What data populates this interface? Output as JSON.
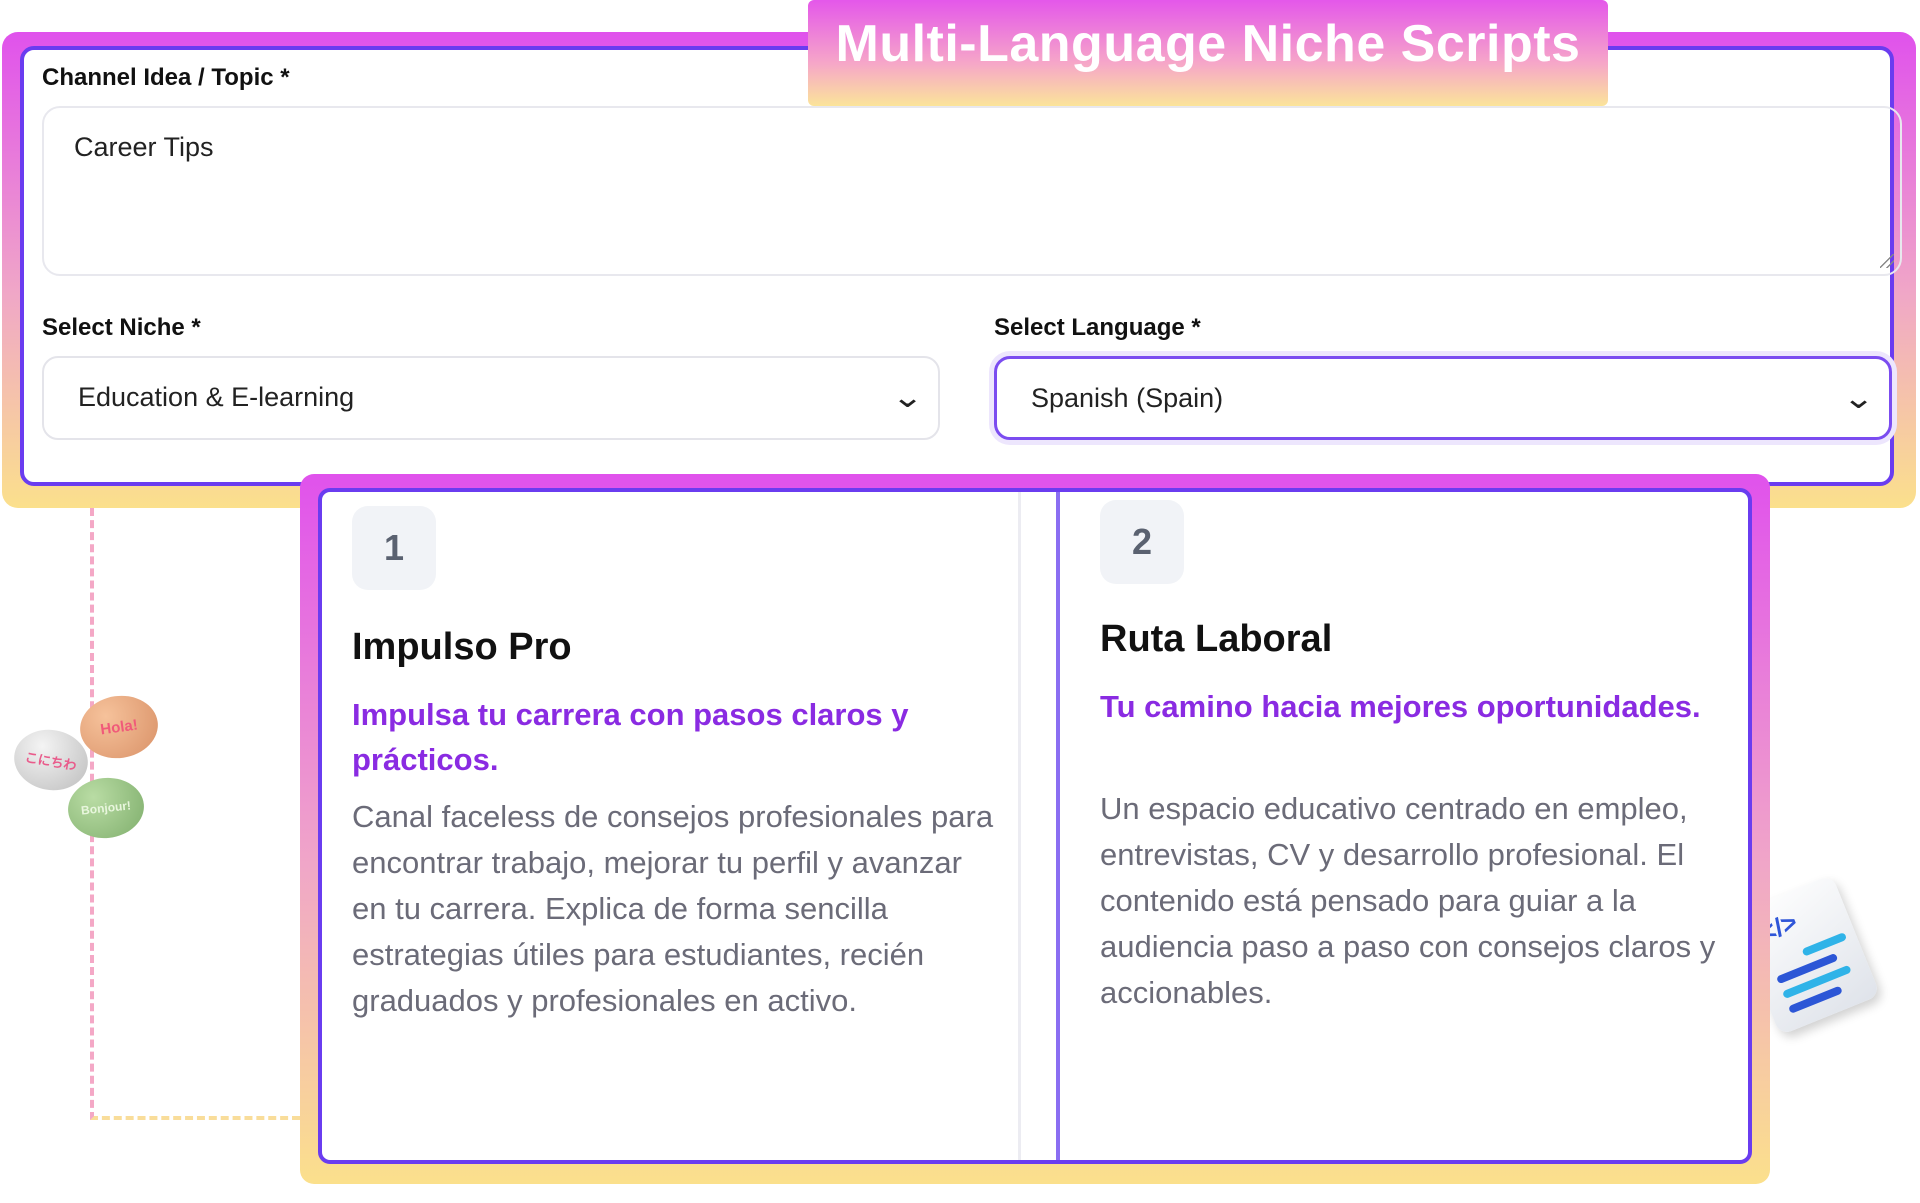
{
  "banner": {
    "title": "Multi-Language Niche Scripts"
  },
  "form": {
    "topic_label": "Channel Idea / Topic *",
    "topic_value": "Career Tips",
    "niche_label": "Select Niche *",
    "niche_value": "Education & E-learning",
    "language_label": "Select Language *",
    "language_value": "Spanish (Spain)"
  },
  "decor": {
    "bubbles": [
      "Hola!",
      "こにちわ",
      "Bonjour!"
    ]
  },
  "cards": [
    {
      "number": "1",
      "title": "Impulso Pro",
      "tagline": "Impulsa tu carrera con pasos claros y prácticos.",
      "description": "Canal faceless de consejos profesionales para encontrar trabajo, mejorar tu perfil y avanzar en tu carrera. Explica de forma sencilla estrategias útiles para estudiantes, recién graduados y profesionales en activo."
    },
    {
      "number": "2",
      "title": "Ruta Laboral",
      "tagline": "Tu camino hacia mejores oportunidades.",
      "description": "Un espacio educativo centrado en empleo, entrevistas, CV y desarrollo profesional. El contenido está pensado para guiar a la audiencia paso a paso con consejos claros y accionables."
    }
  ],
  "colors": {
    "accent": "#6a3cf0",
    "tagline": "#8a2be2",
    "gradient_top": "#e052ec",
    "gradient_bottom": "#fbe08c"
  }
}
